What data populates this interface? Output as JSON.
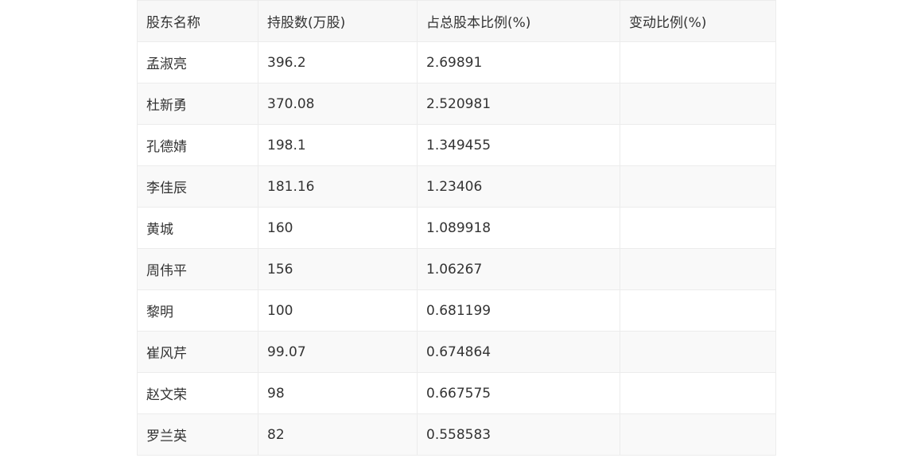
{
  "table": {
    "headers": [
      "股东名称",
      "持股数(万股)",
      "占总股本比例(%)",
      "变动比例(%)"
    ],
    "rows": [
      {
        "name": "孟淑亮",
        "shares": "396.2",
        "ratio": "2.69891",
        "change": ""
      },
      {
        "name": "杜新勇",
        "shares": "370.08",
        "ratio": "2.520981",
        "change": ""
      },
      {
        "name": "孔德婧",
        "shares": "198.1",
        "ratio": "1.349455",
        "change": ""
      },
      {
        "name": "李佳辰",
        "shares": "181.16",
        "ratio": "1.23406",
        "change": ""
      },
      {
        "name": "黄城",
        "shares": "160",
        "ratio": "1.089918",
        "change": ""
      },
      {
        "name": "周伟平",
        "shares": "156",
        "ratio": "1.06267",
        "change": ""
      },
      {
        "name": "黎明",
        "shares": "100",
        "ratio": "0.681199",
        "change": ""
      },
      {
        "name": "崔风芹",
        "shares": "99.07",
        "ratio": "0.674864",
        "change": ""
      },
      {
        "name": "赵文荣",
        "shares": "98",
        "ratio": "0.667575",
        "change": ""
      },
      {
        "name": "罗兰英",
        "shares": "82",
        "ratio": "0.558583",
        "change": ""
      }
    ]
  }
}
